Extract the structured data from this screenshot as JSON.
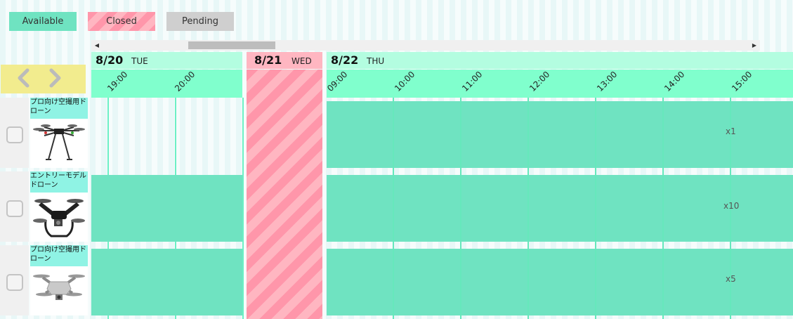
{
  "legend": {
    "available": {
      "label": "Available",
      "color": "#6fe3c1"
    },
    "closed": {
      "label": "Closed",
      "color": "#ff96aa"
    },
    "pending": {
      "label": "Pending",
      "color": "#cfcfcf"
    }
  },
  "navigation": {
    "prev_icon": "chevron-left-icon",
    "next_icon": "chevron-right-icon"
  },
  "days": [
    {
      "date": "8/20",
      "dow": "TUE",
      "status": "available"
    },
    {
      "date": "8/21",
      "dow": "WED",
      "status": "closed"
    },
    {
      "date": "8/22",
      "dow": "THU",
      "status": "available"
    }
  ],
  "time_slots": {
    "day1": [
      "19:00",
      "20:00"
    ],
    "day3": [
      "09:00",
      "10:00",
      "11:00",
      "12:00",
      "13:00",
      "14:00",
      "15:00"
    ]
  },
  "items": [
    {
      "name": "プロ向け空撮用ドローン",
      "quantity_label": "x1",
      "image_icon": "hexacopter-drone-icon"
    },
    {
      "name": "エントリーモデルドローン",
      "quantity_label": "x10",
      "image_icon": "camera-drone-icon"
    },
    {
      "name": "プロ向け空撮用ドローン",
      "quantity_label": "x5",
      "image_icon": "folding-drone-icon"
    }
  ]
}
